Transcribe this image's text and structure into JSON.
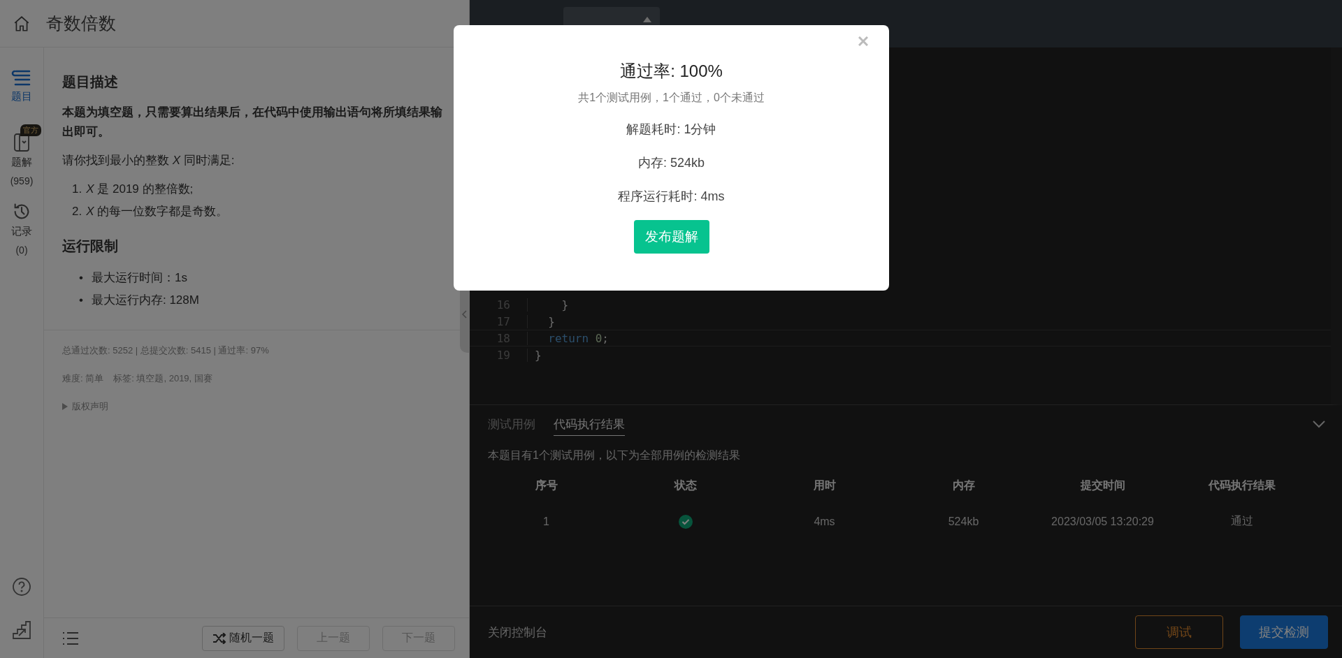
{
  "header": {
    "title": "奇数倍数"
  },
  "nav": [
    {
      "kind": "problem",
      "label": "题目",
      "selected": true
    },
    {
      "kind": "solution",
      "label": "题解",
      "badge": "官方",
      "count": "(959)",
      "selected": false
    },
    {
      "kind": "record",
      "label": "记录",
      "count": "(0)",
      "selected": false
    }
  ],
  "problem": {
    "heading": "题目描述",
    "notice": "本题为填空题，只需要算出结果后，在代码中使用输出语句将所填结果输出即可。",
    "intro": "请你找到最小的整数 *X* 同时满足:",
    "conditions": [
      {
        "marker": "1.",
        "text": "*X* 是 2019 的整倍数;"
      },
      {
        "marker": "2.",
        "text": "*X* 的每一位数字都是奇数。"
      }
    ],
    "limits_heading": "运行限制",
    "limits": [
      {
        "marker": "•",
        "text": "最大运行时间：1s"
      },
      {
        "marker": "•",
        "text": "最大运行内存: 128M"
      }
    ],
    "stats": "总通过次数: 5252  |  总提交次数: 5415  |  通过率: 97%",
    "difficulty": "难度: 简单",
    "tags": "标签: 填空题, 2019, 国赛",
    "copyright": {
      "label": "版权声明",
      "expanded": false
    }
  },
  "footer_nav": [
    {
      "kind": "random",
      "label": "随机一题",
      "disabled": false
    },
    {
      "kind": "prev",
      "label": "上一题",
      "disabled": true
    },
    {
      "kind": "next",
      "label": "下一题",
      "disabled": true
    }
  ],
  "editor": {
    "lines": [
      {
        "number": "16",
        "current": false,
        "tokens": [
          {
            "kind": "plain",
            "text": "    }"
          }
        ]
      },
      {
        "number": "17",
        "current": false,
        "tokens": [
          {
            "kind": "plain",
            "text": "  }"
          }
        ]
      },
      {
        "number": "18",
        "current": true,
        "tokens": [
          {
            "kind": "keyword",
            "text": "  return"
          },
          {
            "kind": "number",
            "text": " 0"
          },
          {
            "kind": "plain",
            "text": ";"
          }
        ]
      },
      {
        "number": "19",
        "current": false,
        "tokens": [
          {
            "kind": "plain",
            "text": "}"
          }
        ]
      }
    ]
  },
  "console": {
    "tabs": [
      {
        "label": "测试用例",
        "selected": false
      },
      {
        "label": "代码执行结果",
        "selected": true
      }
    ],
    "summary": "本题目有1个测试用例，以下为全部用例的检测结果",
    "columns": [
      "序号",
      "状态",
      "用时",
      "内存",
      "提交时间",
      "代码执行结果"
    ],
    "rows": [
      {
        "index": "1",
        "passed": true,
        "time": "4ms",
        "memory": "524kb",
        "submitted": "2023/03/05 13:20:29",
        "result": "通过"
      }
    ],
    "close_label": "关闭控制台",
    "buttons": [
      {
        "kind": "debug",
        "label": "调试"
      },
      {
        "kind": "submit",
        "label": "提交检测"
      }
    ]
  },
  "modal": {
    "title": "通过率: 100%",
    "subtitle": "共1个测试用例，1个通过，0个未通过",
    "details": [
      "解题耗时: 1分钟",
      "内存: 524kb",
      "程序运行耗时: 4ms"
    ],
    "button": "发布题解"
  }
}
